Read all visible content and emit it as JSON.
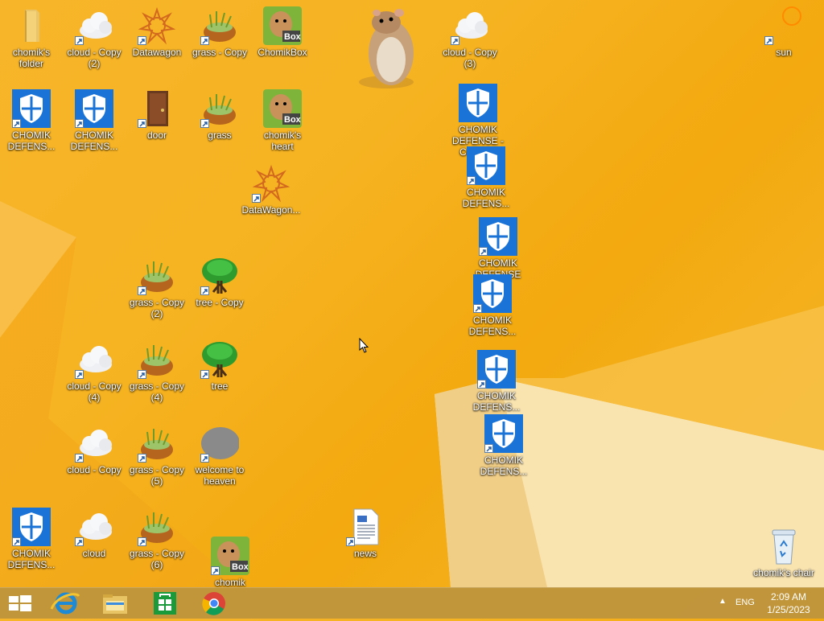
{
  "desktop": {
    "icons": [
      {
        "label": "chomik's folder",
        "type": "folder"
      },
      {
        "label": "cloud - Copy (2)",
        "type": "cloud"
      },
      {
        "label": "Datawagon",
        "type": "datawagon"
      },
      {
        "label": "grass - Copy",
        "type": "grass"
      },
      {
        "label": "ChomikBox",
        "type": "chomikbox"
      },
      {
        "label": "cloud - Copy (3)",
        "type": "cloud"
      },
      {
        "label": "sun",
        "type": "sun"
      },
      {
        "label": "CHOMIK DEFENS...",
        "type": "shield"
      },
      {
        "label": "CHOMIK DEFENS...",
        "type": "shield"
      },
      {
        "label": "door",
        "type": "door"
      },
      {
        "label": "grass",
        "type": "grass"
      },
      {
        "label": "chomik's heart",
        "type": "chomikbox"
      },
      {
        "label": "CHOMIK DEFENSE - Copy (4)",
        "type": "shield"
      },
      {
        "label": "CHOMIK DEFENS...",
        "type": "shield"
      },
      {
        "label": "DataWagon...",
        "type": "datawagon"
      },
      {
        "label": "CHOMIK DEFENSE",
        "type": "shield"
      },
      {
        "label": "grass - Copy (2)",
        "type": "grass"
      },
      {
        "label": "tree - Copy",
        "type": "tree"
      },
      {
        "label": "CHOMIK DEFENS...",
        "type": "shield"
      },
      {
        "label": "cloud - Copy (4)",
        "type": "cloud"
      },
      {
        "label": "grass - Copy (4)",
        "type": "grass"
      },
      {
        "label": "tree",
        "type": "tree"
      },
      {
        "label": "CHOMIK DEFENS...",
        "type": "shield"
      },
      {
        "label": "CHOMIK DEFENS...",
        "type": "shield"
      },
      {
        "label": "cloud - Copy",
        "type": "cloud"
      },
      {
        "label": "grass - Copy (5)",
        "type": "grass"
      },
      {
        "label": "welcome to heaven",
        "type": "blob"
      },
      {
        "label": "CHOMIK DEFENS...",
        "type": "shield"
      },
      {
        "label": "cloud",
        "type": "cloud"
      },
      {
        "label": "grass - Copy (6)",
        "type": "grass"
      },
      {
        "label": "chomik",
        "type": "chomikbox"
      },
      {
        "label": "news",
        "type": "news"
      },
      {
        "label": "chomik's chair",
        "type": "recycle"
      }
    ]
  },
  "taskbar": {
    "buttons": [
      {
        "name": "start-button",
        "icon": "windows-logo"
      },
      {
        "name": "internet-explorer",
        "icon": "ie-icon"
      },
      {
        "name": "file-explorer",
        "icon": "folder-icon"
      },
      {
        "name": "store",
        "icon": "store-icon"
      },
      {
        "name": "chrome",
        "icon": "chrome-icon"
      }
    ],
    "tray": {
      "language": "ENG",
      "time": "2:09 AM",
      "date": "1/25/2023"
    }
  },
  "colors": {
    "wallpaper": "#f6b321",
    "shield": "#1a73d6",
    "taskbar": "#bf943c"
  }
}
